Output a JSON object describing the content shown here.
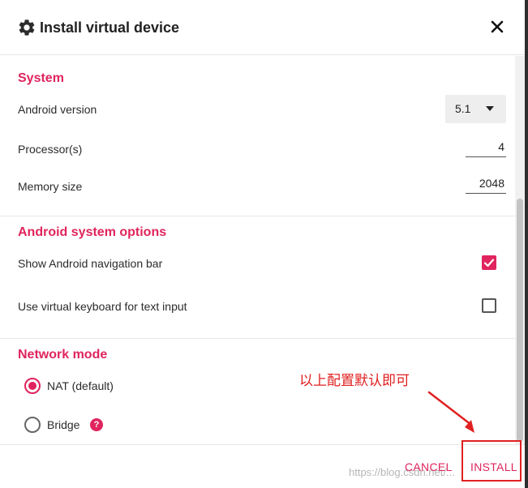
{
  "header": {
    "title": "Install virtual device",
    "gear_icon": "gear-icon",
    "close_icon": "close-icon"
  },
  "system": {
    "title": "System",
    "android_version": {
      "label": "Android version",
      "value": "5.1"
    },
    "processors": {
      "label": "Processor(s)",
      "value": "4"
    },
    "memory": {
      "label": "Memory size",
      "value": "2048"
    }
  },
  "android_options": {
    "title": "Android system options",
    "nav_bar": {
      "label": "Show Android navigation bar",
      "checked": true
    },
    "virtual_keyboard": {
      "label": "Use virtual keyboard for text input",
      "checked": false
    }
  },
  "network": {
    "title": "Network mode",
    "options": [
      {
        "label": "NAT (default)",
        "selected": true
      },
      {
        "label": "Bridge",
        "selected": false
      }
    ],
    "help_glyph": "?"
  },
  "annotation": {
    "text": "以上配置默认即可",
    "color": "#e02020"
  },
  "footer": {
    "cancel_label": "CANCEL",
    "install_label": "INSTALL"
  },
  "watermark": "https://blog.csdn.net/..."
}
